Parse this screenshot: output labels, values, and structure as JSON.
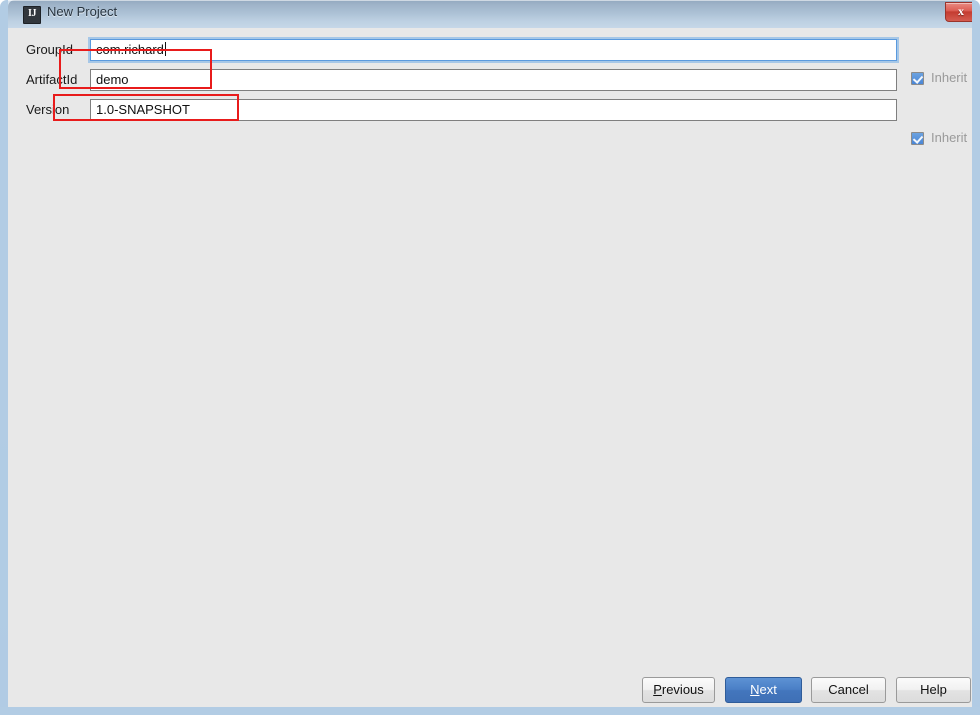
{
  "window": {
    "title": "New Project",
    "icon_label": "IJ",
    "icon_name": "intellij-idea-icon",
    "close_glyph": "x"
  },
  "form": {
    "fields": [
      {
        "label": "GroupId",
        "value": "com.richard",
        "focused": true,
        "inherit_label": "Inherit",
        "inherit_checked": true
      },
      {
        "label": "ArtifactId",
        "value": "demo",
        "focused": false,
        "inherit_label": "",
        "inherit_checked": false
      },
      {
        "label": "Version",
        "value": "1.0-SNAPSHOT",
        "focused": false,
        "inherit_label": "Inherit",
        "inherit_checked": true
      }
    ]
  },
  "annotations": {
    "color": "#e81b1b",
    "boxes": [
      {
        "target": "groupid-field"
      },
      {
        "target": "artifactid-field"
      }
    ]
  },
  "buttons": {
    "previous": {
      "label_pre": "",
      "mnemonic": "P",
      "label_post": "revious"
    },
    "next": {
      "label_pre": "",
      "mnemonic": "N",
      "label_post": "ext"
    },
    "cancel": {
      "label": "Cancel"
    },
    "help": {
      "label": "Help"
    }
  },
  "colors": {
    "accent": "#4a7fc6",
    "annotation": "#e81b1b",
    "checkbox": "#4a86d6",
    "client_bg": "#e8e8e8"
  }
}
